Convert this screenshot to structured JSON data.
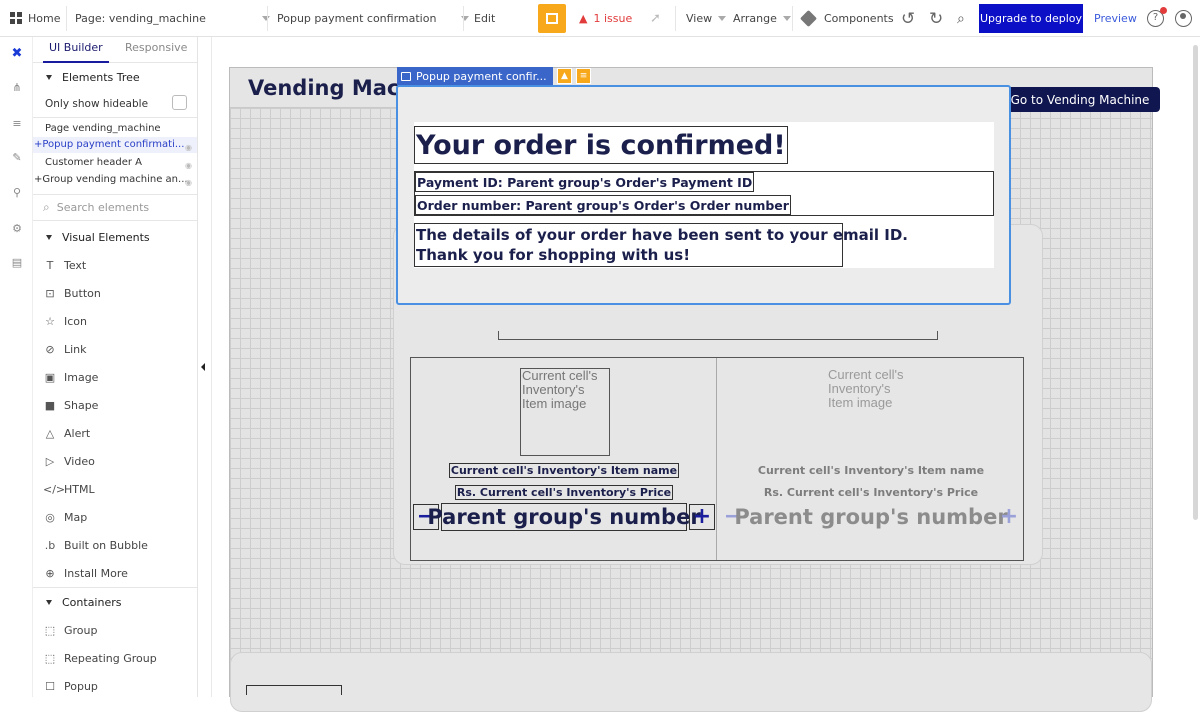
{
  "topbar": {
    "home_label": "Home",
    "page_label": "Page: vending_machine",
    "element_label": "Popup payment confirmation",
    "edit_label": "Edit",
    "issues_label": "1 issue",
    "view_label": "View",
    "arrange_label": "Arrange",
    "components_label": "Components",
    "upgrade_label": "Upgrade to deploy",
    "preview_label": "Preview"
  },
  "panel": {
    "tab_builder": "UI Builder",
    "tab_responsive": "Responsive",
    "elements_tree_label": "Elements Tree",
    "only_hideable_label": "Only show hideable",
    "tree": [
      {
        "label": "Page vending_machine"
      },
      {
        "label": "+Popup payment confirmati..."
      },
      {
        "label": "Customer header A"
      },
      {
        "label": "+Group vending machine an..."
      }
    ],
    "search_placeholder": "Search elements",
    "visual_elements_label": "Visual Elements",
    "visual_elements": [
      {
        "label": "Text",
        "icon": "T"
      },
      {
        "label": "Button",
        "icon": "⊡"
      },
      {
        "label": "Icon",
        "icon": "☆"
      },
      {
        "label": "Link",
        "icon": "⊘"
      },
      {
        "label": "Image",
        "icon": "▣"
      },
      {
        "label": "Shape",
        "icon": "■"
      },
      {
        "label": "Alert",
        "icon": "△"
      },
      {
        "label": "Video",
        "icon": "▷"
      },
      {
        "label": "HTML",
        "icon": "</>"
      },
      {
        "label": "Map",
        "icon": "◎"
      },
      {
        "label": "Built on Bubble",
        "icon": ".b"
      },
      {
        "label": "Install More",
        "icon": "⊕"
      }
    ],
    "containers_label": "Containers",
    "containers": [
      {
        "label": "Group",
        "icon": "⬚"
      },
      {
        "label": "Repeating Group",
        "icon": "⬚"
      },
      {
        "label": "Popup",
        "icon": "☐"
      }
    ]
  },
  "canvas": {
    "header_title": "Vending Mach",
    "goto_button": "Go to Vending Machine",
    "cell1": {
      "image_text": "Current cell's Inventory's Item image",
      "item_name": "Current cell's Inventory's Item name",
      "item_price": "Rs. Current cell's Inventory's Price",
      "minus": "−",
      "qty_text": "Parent group's number",
      "plus": "+"
    },
    "cell2": {
      "image_text": "Current cell's Inventory's Item image",
      "item_name": "Current cell's Inventory's Item name",
      "item_price": "Rs. Current cell's Inventory's Price",
      "minus": "−",
      "qty_text": "Parent group's number",
      "plus": "+"
    }
  },
  "popup": {
    "label": "Popup payment confir...",
    "title": "Your order is confirmed!",
    "payment_id": "Payment ID: Parent group's Order's Payment ID",
    "order_number": "Order number: Parent group's Order's Order number",
    "details_line1": "The details of your order have been sent to your email ID.",
    "details_line2": "Thank you for shopping with us!"
  }
}
